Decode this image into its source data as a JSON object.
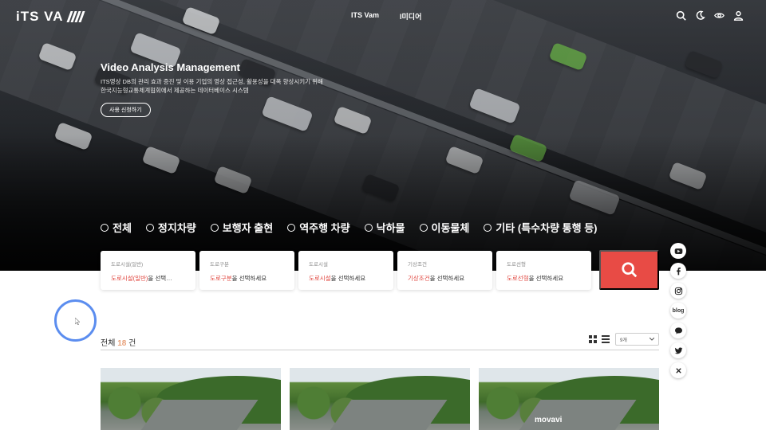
{
  "header": {
    "logo_text": "iTS VA",
    "nav": [
      "ITS Vam",
      "I미디어"
    ],
    "icons": [
      "search-icon",
      "moon-icon",
      "eye-icon",
      "user-icon"
    ]
  },
  "hero": {
    "title": "Video Analysis Management",
    "desc_line1": "ITS영상 DB의 관리 효과 증진 및 이용 기업의 영상 접근성, 활용성을 대폭 향상시키기 위해",
    "desc_line2": "한국지능형교통체계협회에서 제공하는 데이터베이스 시스템",
    "apply_label": "사용 신청하기"
  },
  "categories": [
    "전체",
    "정지차량",
    "보행자 출현",
    "역주행 차량",
    "낙하물",
    "이동물체",
    "기타 (특수차량 통행 등)"
  ],
  "filters": [
    {
      "label": "도로시설(일반)",
      "highlight": "도로시설(일반)",
      "rest": "을 선택…"
    },
    {
      "label": "도로구분",
      "highlight": "도로구분",
      "rest": "을 선택하세요"
    },
    {
      "label": "도로시설",
      "highlight": "도로시설",
      "rest": "을 선택하세요"
    },
    {
      "label": "기상조건",
      "highlight": "기상조건",
      "rest": "을 선택하세요"
    },
    {
      "label": "도로선형",
      "highlight": "도로선형",
      "rest": "을 선택하세요"
    }
  ],
  "side": [
    "youtube-icon",
    "facebook-icon",
    "instagram-icon",
    "blog-icon",
    "talk-icon",
    "twitter-icon",
    "close-icon"
  ],
  "side_blog_label": "blog",
  "results": {
    "prefix": "전체",
    "count": "18",
    "suffix": "건",
    "per_page": "9개"
  },
  "thumb_watermark": "movavi",
  "colors": {
    "accent": "#e84b45",
    "count": "#e8a27c",
    "ring": "#5b8def"
  }
}
